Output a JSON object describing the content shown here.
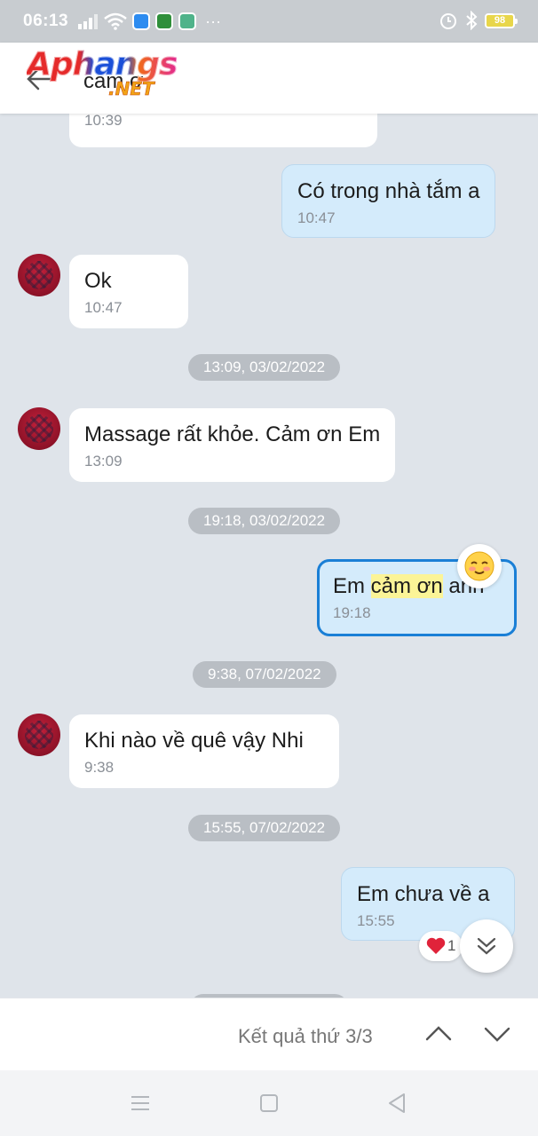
{
  "status_bar": {
    "time": "06:13",
    "battery": "98",
    "dots": "···"
  },
  "header": {
    "title": "cam ơ",
    "watermark_main": "Aphangs",
    "watermark_sub": ".NET"
  },
  "messages": [
    {
      "direction": "in",
      "text": "",
      "time": "10:39"
    },
    {
      "direction": "out",
      "text": "Có trong nhà tắm a",
      "time": "10:47"
    },
    {
      "direction": "in",
      "text": "Ok",
      "time": "10:47"
    },
    {
      "direction": "in",
      "text": "Massage rất khỏe. Cảm ơn Em",
      "time": "13:09"
    },
    {
      "direction": "out",
      "text_before": "Em ",
      "text_highlight": "cảm ơn",
      "text_after": " anh",
      "time": "19:18",
      "reaction": "smile-emoji"
    },
    {
      "direction": "in",
      "text": "Khi nào về quê vậy Nhi",
      "time": "9:38"
    },
    {
      "direction": "out",
      "text": "Em chưa về a",
      "time": "15:55",
      "reaction": "heart",
      "reaction_count": "1"
    }
  ],
  "date_separators": [
    "13:09, 03/02/2022",
    "19:18, 03/02/2022",
    "9:38, 07/02/2022",
    "15:55, 07/02/2022"
  ],
  "search_result": {
    "label": "Kết quả thứ 3/3"
  },
  "colors": {
    "chat_bg": "#dfe4ea",
    "outgoing_bubble": "#d4ebfb",
    "highlight_border": "#1a7fd6",
    "search_highlight": "#fbf497"
  }
}
